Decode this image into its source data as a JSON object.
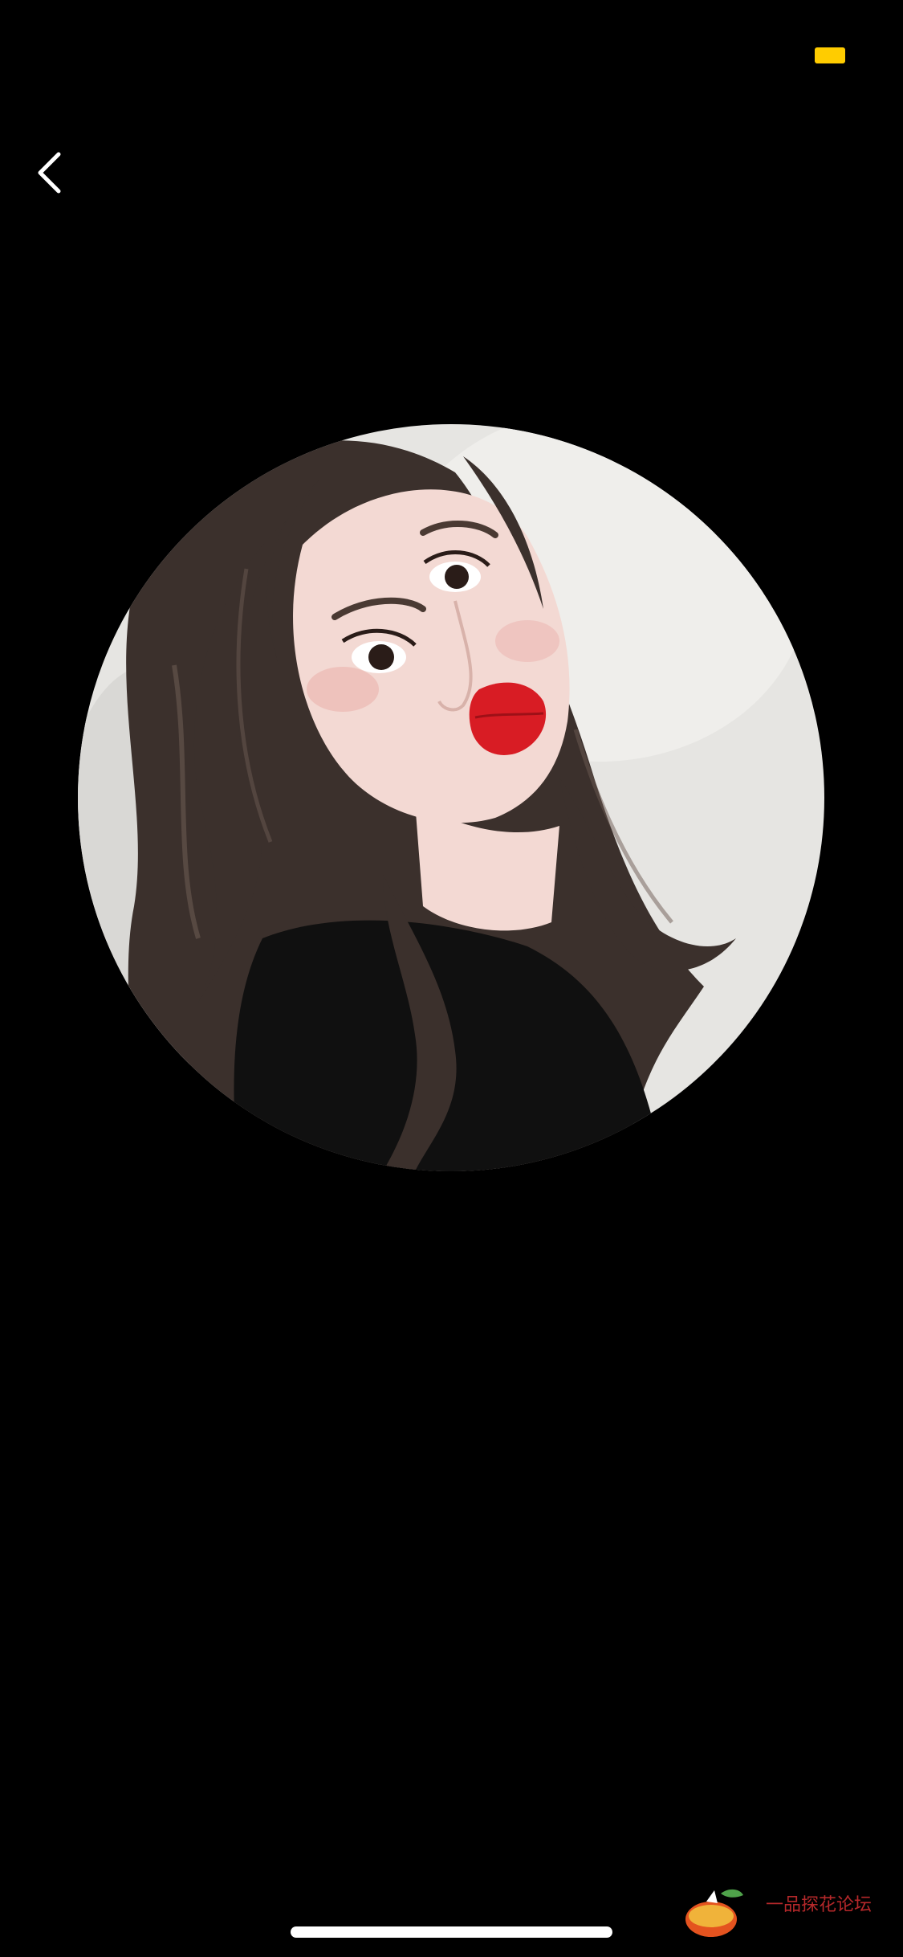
{
  "colors": {
    "background": "#000000",
    "battery": "#FFCC00",
    "back_arrow": "#FFFFFF",
    "home_indicator": "#FFFFFF",
    "watermark_text": "#B5282A",
    "photo_wall": "#E6E5E2",
    "hair": "#3B302C",
    "sweater": "#101010",
    "skin": "#F3D9D3",
    "lips": "#D81C24"
  },
  "status_bar": {
    "battery_icon": "battery-icon"
  },
  "navigation": {
    "back_icon": "chevron-left-icon"
  },
  "avatar": {
    "icon": "profile-photo"
  },
  "watermark": {
    "text": "一品探花论坛"
  }
}
